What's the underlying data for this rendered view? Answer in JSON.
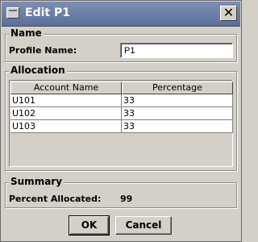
{
  "window": {
    "title": "Edit P1",
    "close_glyph": "✕"
  },
  "name_group": {
    "title": "Name",
    "profile_label": "Profile Name:",
    "profile_value": "P1"
  },
  "allocation": {
    "title": "Allocation",
    "columns": [
      "Account Name",
      "Percentage"
    ],
    "rows": [
      {
        "account": "U101",
        "percentage": "33"
      },
      {
        "account": "U102",
        "percentage": "33"
      },
      {
        "account": "U103",
        "percentage": "33"
      }
    ]
  },
  "summary": {
    "title": "Summary",
    "percent_label": "Percent Allocated:",
    "percent_value": "99"
  },
  "buttons": {
    "ok": "OK",
    "cancel": "Cancel"
  }
}
